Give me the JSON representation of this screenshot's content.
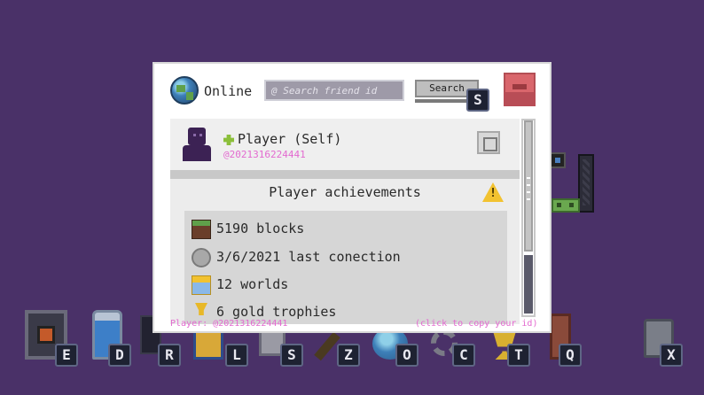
{
  "friends_panel": {
    "status_label": "Online",
    "search": {
      "placeholder": "@ Search friend id",
      "value": ""
    },
    "search_button_label": "Search",
    "search_shortcut_key": "S"
  },
  "player": {
    "name": "Player (Self)",
    "id": "@2021316224441"
  },
  "achievements": {
    "title": "Player achievements",
    "items": [
      {
        "icon": "grass-block-icon",
        "text": "5190 blocks"
      },
      {
        "icon": "clock-icon",
        "text": "3/6/2021 last conection"
      },
      {
        "icon": "folder-icon",
        "text": "12 worlds"
      },
      {
        "icon": "trophy-icon",
        "text": "6 gold trophies"
      }
    ]
  },
  "footer": {
    "player_id_text": "Player: @2021316224441",
    "copy_hint": "(click to copy your id)"
  },
  "hotbar": {
    "keys": [
      "E",
      "D",
      "R",
      "L",
      "S",
      "Z",
      "O",
      "C",
      "T",
      "Q",
      "X"
    ]
  },
  "colors": {
    "background": "#4a3168",
    "accent_pink": "#e36ad0",
    "close_red": "#d9666c"
  }
}
